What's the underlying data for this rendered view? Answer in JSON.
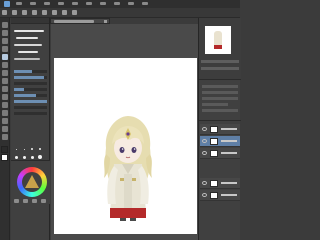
{
  "app": {
    "window_title": ""
  },
  "menubar": {
    "items": [
      "",
      "",
      "",
      "",
      "",
      "",
      "",
      "",
      "",
      ""
    ]
  },
  "canvas_tab": {
    "label": ""
  },
  "colors": {
    "accent": "#5f7fa6",
    "canvas": "#ffffff",
    "panel": "#404040",
    "character_dress": "#e8e4d4",
    "character_accent": "#b42a2a",
    "character_hair": "#e6ddb0"
  },
  "icons": {
    "tools": [
      "pen-tool-icon",
      "brush-tool-icon",
      "eraser-tool-icon",
      "fill-tool-icon",
      "select-tool-icon",
      "move-tool-icon",
      "text-tool-icon",
      "eyedropper-tool-icon"
    ],
    "commands": [
      "new-icon",
      "open-icon",
      "save-icon",
      "undo-icon",
      "redo-icon",
      "clear-icon",
      "transform-icon",
      "settings-icon"
    ]
  },
  "subtool": {
    "brush_sizes": 20
  },
  "layers": {
    "items": [
      {
        "visible": true,
        "active": false
      },
      {
        "visible": true,
        "active": true
      },
      {
        "visible": true,
        "active": false
      },
      {
        "visible": true,
        "active": false
      },
      {
        "visible": true,
        "active": false
      }
    ]
  }
}
